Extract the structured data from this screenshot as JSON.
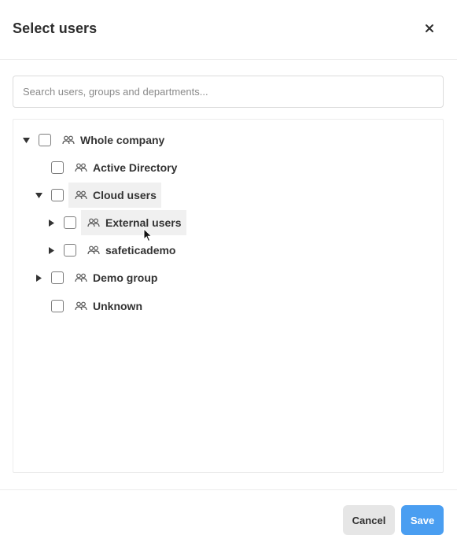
{
  "dialog": {
    "title": "Select users",
    "close_icon": "close-icon",
    "search": {
      "placeholder": "Search users, groups and departments...",
      "value": ""
    },
    "tree": [
      {
        "label": "Whole company",
        "level": 0,
        "expandable": true,
        "expanded": true,
        "checked": false
      },
      {
        "label": "Active Directory",
        "level": 1,
        "expandable": false,
        "expanded": false,
        "checked": false
      },
      {
        "label": "Cloud users",
        "level": 1,
        "expandable": true,
        "expanded": true,
        "checked": false
      },
      {
        "label": "External users",
        "level": 2,
        "expandable": true,
        "expanded": false,
        "checked": false
      },
      {
        "label": "safeticademo",
        "level": 2,
        "expandable": true,
        "expanded": false,
        "checked": false
      },
      {
        "label": "Demo group",
        "level": 1,
        "expandable": true,
        "expanded": false,
        "checked": false
      },
      {
        "label": "Unknown",
        "level": 1,
        "expandable": false,
        "expanded": false,
        "checked": false
      }
    ],
    "buttons": {
      "cancel": "Cancel",
      "save": "Save"
    }
  },
  "colors": {
    "primary": "#4a9ef1",
    "secondary_button": "#e6e6e6",
    "hover_row": "#f0f0f0",
    "text": "#333333"
  },
  "icons": {
    "group": "users-group-icon",
    "expanded": "caret-down-icon",
    "collapsed": "caret-right-icon",
    "cursor": "mouse-pointer-icon"
  }
}
